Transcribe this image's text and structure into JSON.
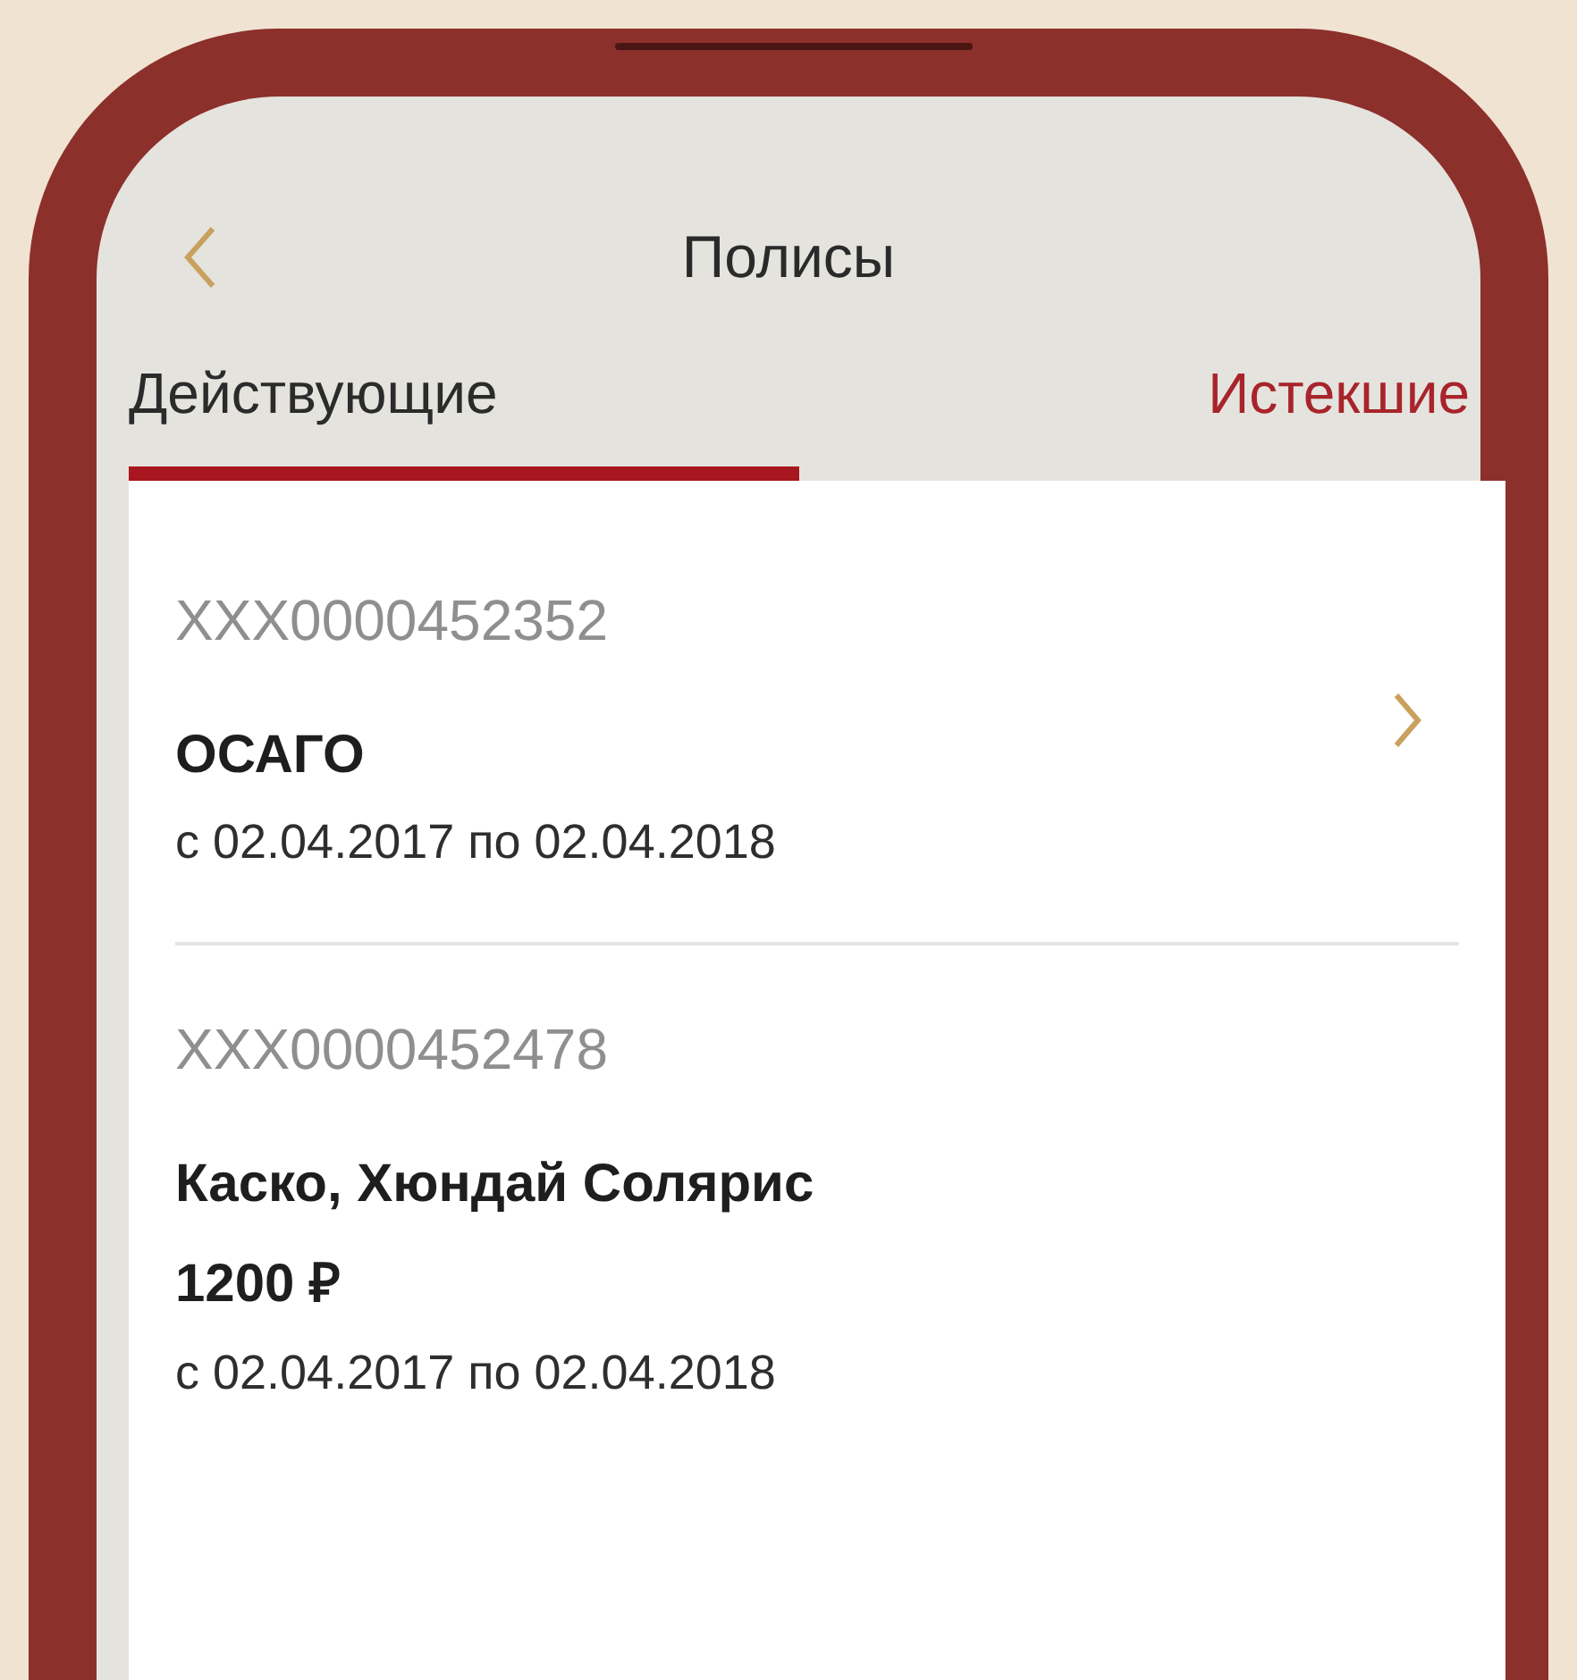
{
  "header": {
    "title": "Полисы"
  },
  "tabs": [
    {
      "label": "Действующие",
      "selected": true
    },
    {
      "label": "Истекшие",
      "selected": false
    }
  ],
  "policies": [
    {
      "number": "XXX0000452352",
      "title": "ОСАГО",
      "period": "с 02.04.2017 по 02.04.2018",
      "has_chevron": true
    },
    {
      "number": "XXX0000452478",
      "title": "Каско, Хюндай Солярис",
      "price": "1200 ₽",
      "period": "с 02.04.2017 по 02.04.2018",
      "has_chevron": false
    }
  ]
}
